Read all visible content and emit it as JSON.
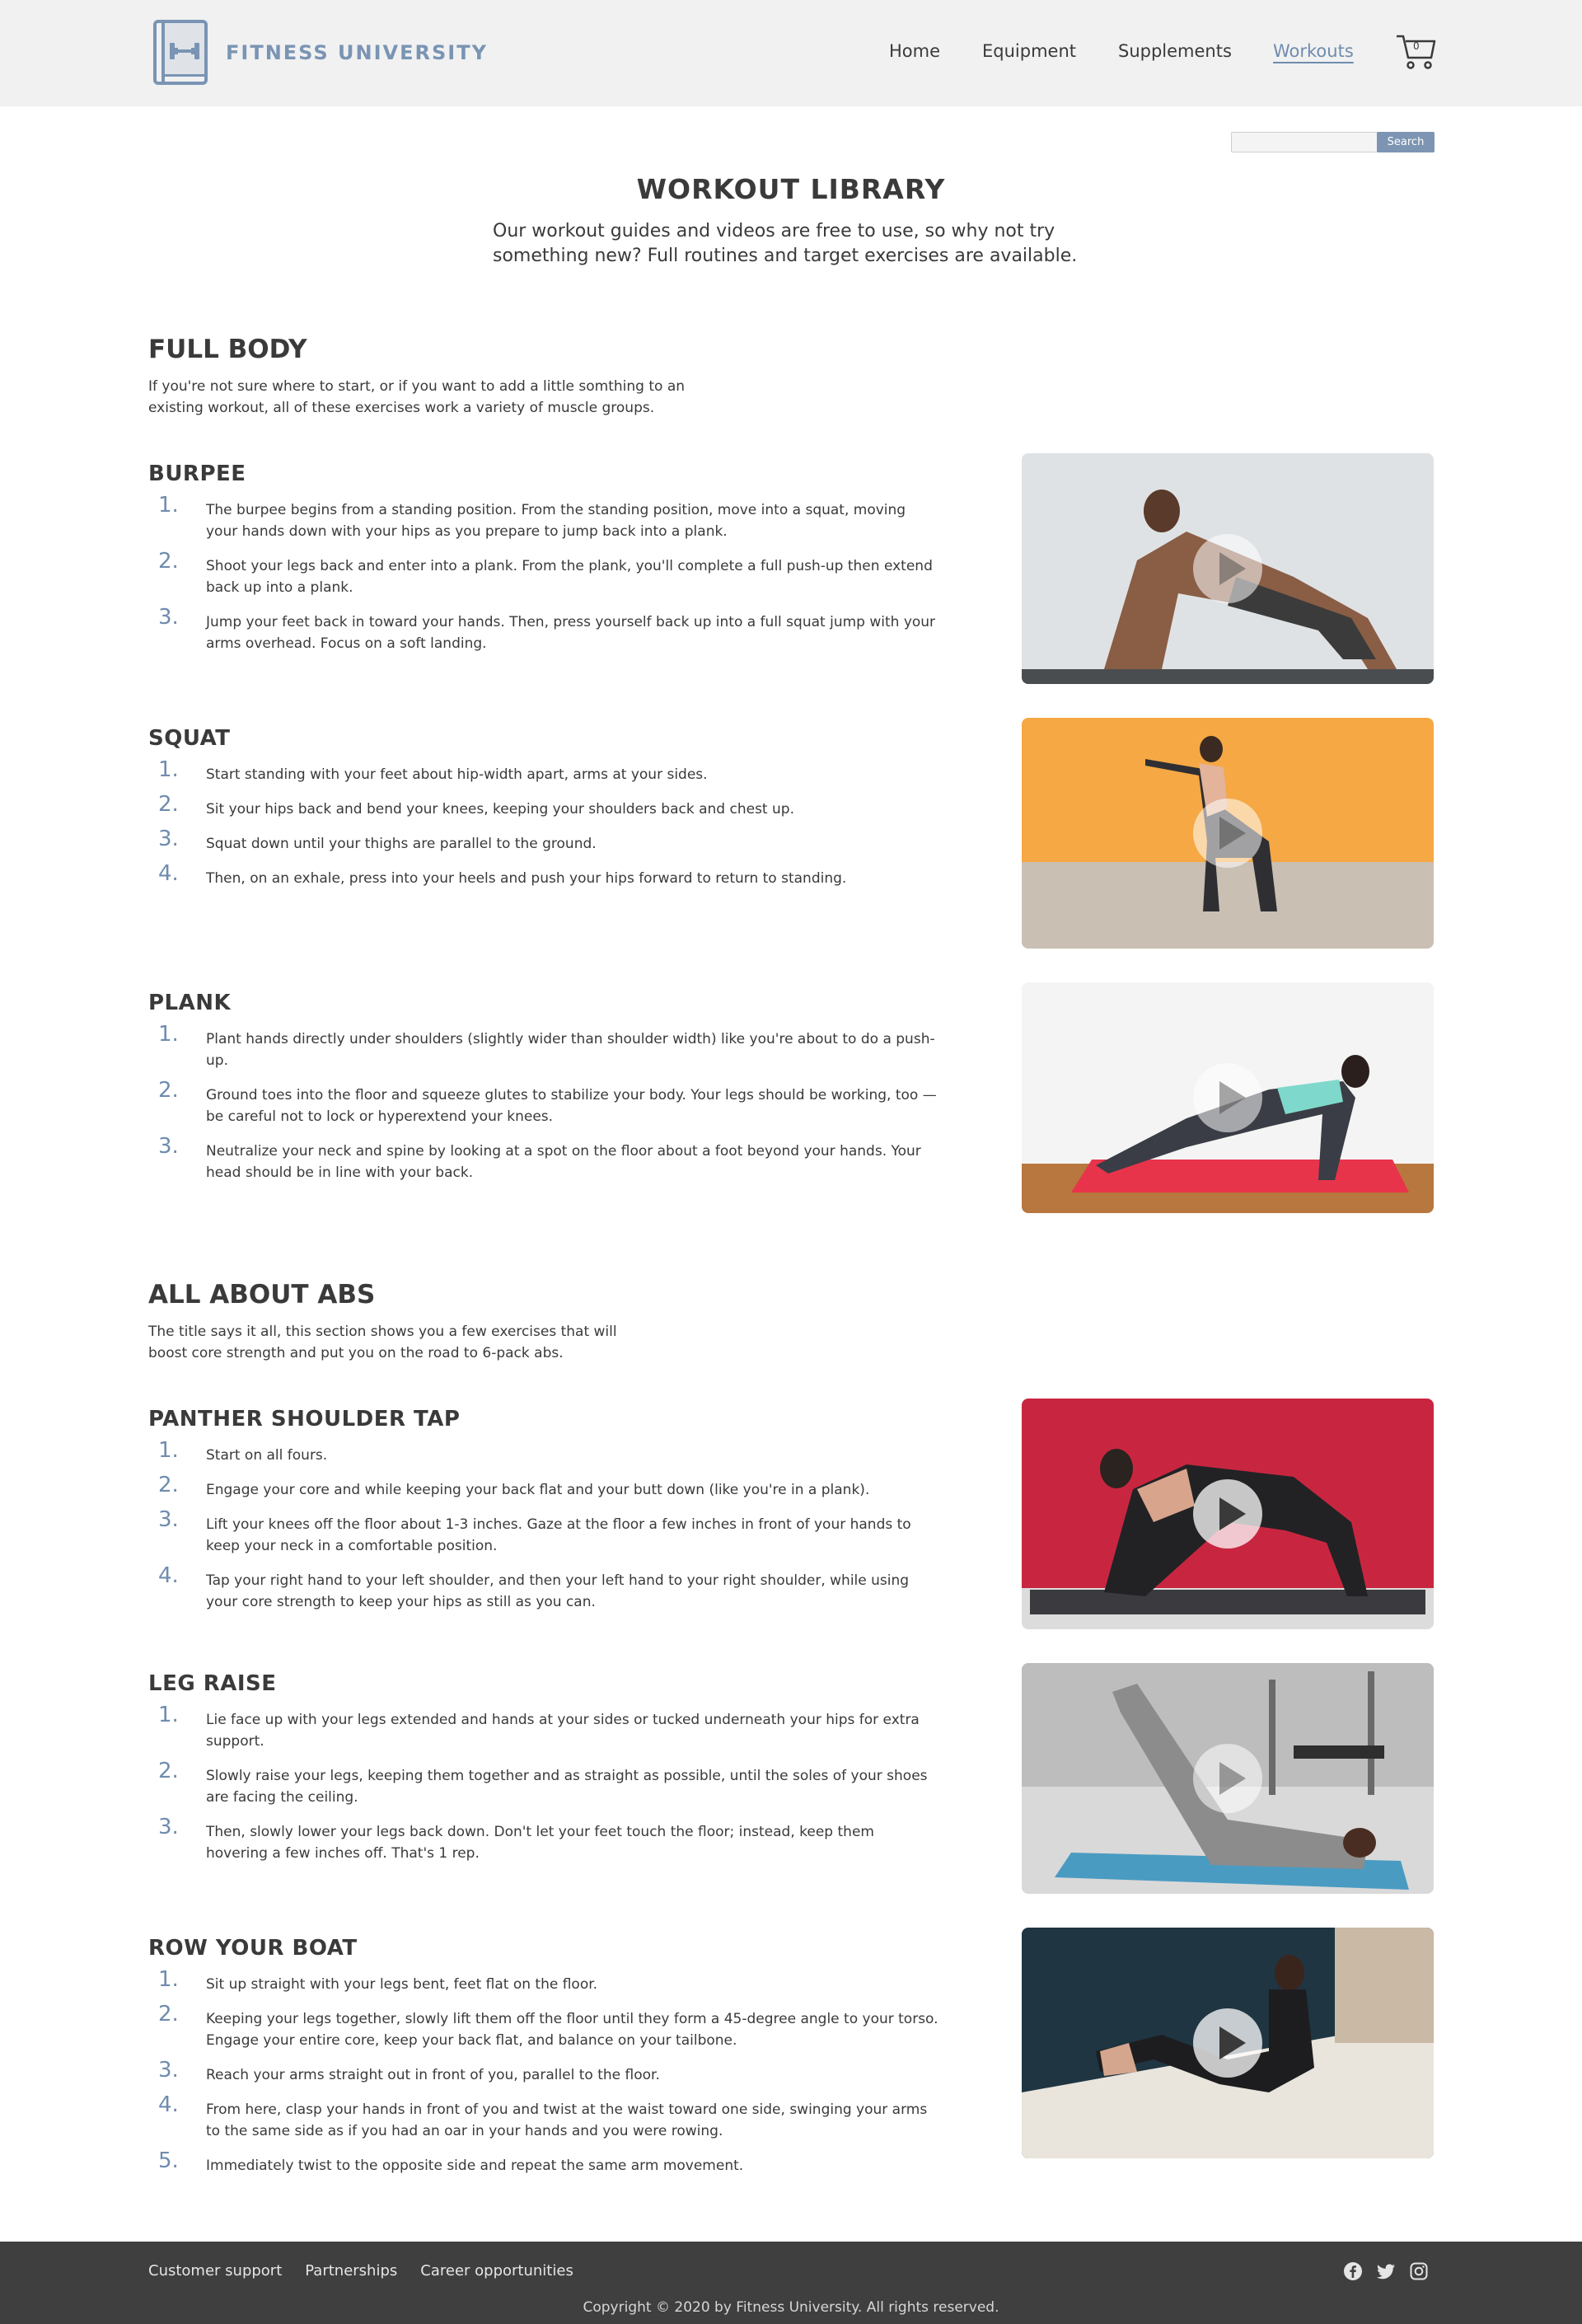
{
  "brand": {
    "name": "FITNESS UNIVERSITY",
    "logo_icon": "dumbbell-book-icon",
    "color": "#7a94b4"
  },
  "nav": {
    "items": [
      {
        "label": "Home",
        "active": false
      },
      {
        "label": "Equipment",
        "active": false
      },
      {
        "label": "Supplements",
        "active": false
      },
      {
        "label": "Workouts",
        "active": true
      }
    ],
    "cart_count": "0",
    "cart_icon": "shopping-cart-icon"
  },
  "search": {
    "placeholder": "",
    "button_label": "Search"
  },
  "page": {
    "title": "WORKOUT LIBRARY",
    "intro": "Our workout guides and videos are free to use, so why not try something new? Full routines and target exercises are available."
  },
  "sections": [
    {
      "title": "FULL BODY",
      "description": "If you're not sure where to start, or if you want to add a little somthing to an existing workout, all of these exercises work a variety of muscle groups.",
      "exercises": [
        {
          "title": "BURPEE",
          "steps": [
            "The burpee begins from a standing position. From the standing position, move into a squat, moving your hands down with your hips as you prepare to jump back into a plank.",
            "Shoot your legs back and enter into a plank. From the plank, you'll complete a full push-up then extend back up into a plank.",
            "Jump your feet back in toward your hands. Then, press yourself back up into a full squat jump with your arms overhead. Focus on a soft landing."
          ]
        },
        {
          "title": "SQUAT",
          "steps": [
            "Start standing with your feet about hip-width apart, arms at your sides.",
            "Sit your hips back and bend your knees, keeping your shoulders back and chest up.",
            "Squat down until your thighs are parallel to the ground.",
            "Then, on an exhale, press into your heels and push your hips forward to return to standing."
          ]
        },
        {
          "title": "PLANK",
          "steps": [
            "Plant hands directly under shoulders (slightly wider than shoulder width) like you're about to do a push-up.",
            "Ground toes into the floor and squeeze glutes to stabilize your body. Your legs should be working, too — be careful not to lock or hyperextend your knees.",
            "Neutralize your neck and spine by looking at a spot on the floor about a foot beyond your hands. Your head should be in line with your back."
          ]
        }
      ]
    },
    {
      "title": "ALL ABOUT ABS",
      "description": "The title says it all, this section shows you a few exercises that will boost core strength and put you on the road to 6-pack abs.",
      "exercises": [
        {
          "title": "PANTHER SHOULDER TAP",
          "steps": [
            "Start on all fours.",
            "Engage your core and while keeping your back flat and your butt down (like you're in a plank).",
            "Lift your knees off the floor about 1-3 inches. Gaze at the floor a few inches in front of your hands to keep your neck in a comfortable position.",
            "Tap your right hand to your left shoulder, and then your left hand to your right shoulder, while using your core strength to keep your hips as still as you can."
          ]
        },
        {
          "title": "LEG RAISE",
          "steps": [
            "Lie face up with your legs extended and hands at your sides or tucked underneath your hips for extra support.",
            "Slowly raise your legs, keeping them together and as straight as possible, until the soles of your shoes are facing the ceiling.",
            "Then, slowly lower your legs back down. Don't let your feet touch the floor; instead, keep them hovering a few inches off. That's 1 rep."
          ]
        },
        {
          "title": "ROW YOUR BOAT",
          "steps": [
            "Sit up straight with your legs bent, feet flat on the floor.",
            "Keeping your legs together, slowly lift them off the floor until they form a 45-degree angle to your torso. Engage your entire core, keep your back flat, and balance on your tailbone.",
            "Reach your arms straight out in front of you, parallel to the floor.",
            "From here, clasp your hands in front of you and twist at the waist toward one side, swinging your arms to the same side as if you had an oar in your hands and you were rowing.",
            "Immediately twist to the opposite side and repeat the same arm movement."
          ]
        }
      ]
    }
  ],
  "footer": {
    "links": [
      "Customer support",
      "Partnerships",
      "Career opportunities"
    ],
    "social_icons": [
      "facebook-icon",
      "twitter-icon",
      "instagram-icon"
    ],
    "copyright": "Copyright © 2020 by Fitness University. All rights reserved."
  }
}
